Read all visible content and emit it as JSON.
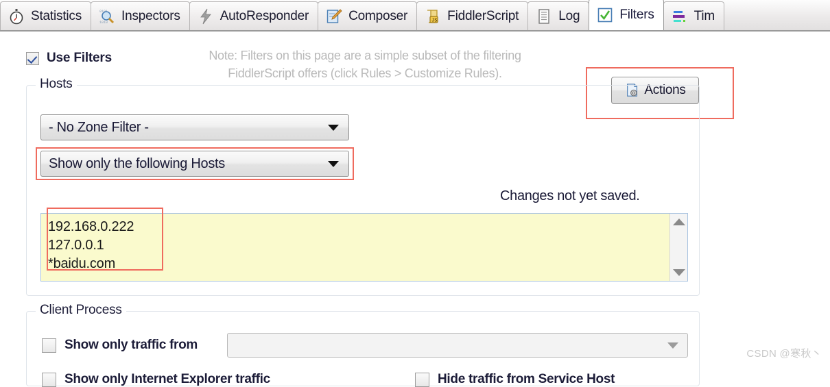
{
  "tabs": [
    {
      "label": "Statistics",
      "icon": "stopwatch-icon",
      "active": false
    },
    {
      "label": "Inspectors",
      "icon": "magnifier-icon",
      "active": false
    },
    {
      "label": "AutoResponder",
      "icon": "lightning-icon",
      "active": false
    },
    {
      "label": "Composer",
      "icon": "notepad-pencil-icon",
      "active": false
    },
    {
      "label": "FiddlerScript",
      "icon": "js-scroll-icon",
      "active": false
    },
    {
      "label": "Log",
      "icon": "document-icon",
      "active": false
    },
    {
      "label": "Filters",
      "icon": "green-check-icon",
      "active": true
    },
    {
      "label": "Tim",
      "icon": "timeline-bars-icon",
      "active": false
    }
  ],
  "use_filters": {
    "label": "Use Filters",
    "checked": true
  },
  "note": {
    "line1": "Note: Filters on this page are a simple subset of the filtering",
    "line2": "FiddlerScript offers (click Rules > Customize Rules)."
  },
  "actions": {
    "label": "Actions",
    "icon": "document-gear-icon"
  },
  "hosts": {
    "title": "Hosts",
    "zone_filter": "- No Zone Filter -",
    "host_mode": "Show only the following Hosts",
    "changes_status": "Changes not yet saved.",
    "host_list": "192.168.0.222\n127.0.0.1\n*baidu.com"
  },
  "client_process": {
    "title": "Client Process",
    "show_only_traffic_from": "Show only traffic from",
    "process_value": "",
    "show_only_ie": "Show only Internet Explorer traffic",
    "hide_service_host": "Hide traffic from Service Host"
  },
  "watermark": "CSDN @寒秋丶",
  "colors": {
    "highlight": "#ef6b5e",
    "host_textarea_bg": "#fafacd",
    "note_text": "#b9b9b9",
    "accent_check": "#2d4f9e"
  }
}
